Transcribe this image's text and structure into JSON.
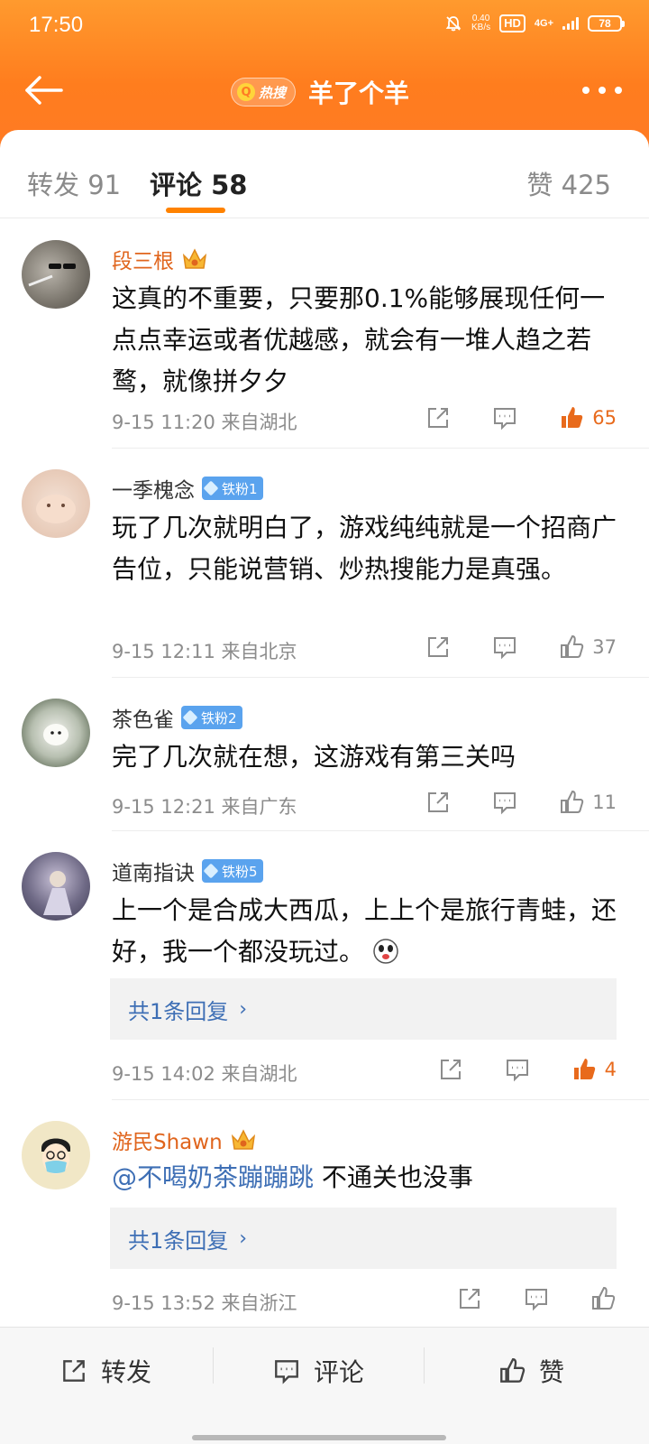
{
  "status_bar": {
    "time": "17:50",
    "speed_value": "0.40",
    "speed_unit": "KB/s",
    "hd_label": "HD",
    "network": "4G+",
    "battery": "78"
  },
  "nav": {
    "hot_badge": "热搜",
    "title": "羊了个羊"
  },
  "tabs": {
    "repost": "转发 91",
    "comments": "评论 58",
    "likes": "赞 425"
  },
  "comments": [
    {
      "user": "段三根",
      "user_type": "vip",
      "text": "这真的不重要，只要那0.1%能够展现任何一点点幸运或者优越感，就会有一堆人趋之若鹜，就像拼夕夕",
      "time": "9-15 11:20",
      "location": "来自湖北",
      "likes": "65",
      "liked": true
    },
    {
      "user": "一季槐念",
      "user_type": "normal",
      "badge": "铁粉1",
      "text": "玩了几次就明白了，游戏纯纯就是一个招商广告位，只能说营销、炒热搜能力是真强。",
      "time": "9-15 12:11",
      "location": "来自北京",
      "likes": "37",
      "liked": false
    },
    {
      "user": "茶色雀",
      "user_type": "normal",
      "badge": "铁粉2",
      "text": "完了几次就在想，这游戏有第三关吗",
      "time": "9-15 12:21",
      "location": "来自广东",
      "likes": "11",
      "liked": false
    },
    {
      "user": "道南指诀",
      "user_type": "normal",
      "badge": "铁粉5",
      "text": "上一个是合成大西瓜，上上个是旅行青蛙，还好，我一个都没玩过。",
      "reply_summary": "共1条回复",
      "time": "9-15 14:02",
      "location": "来自湖北",
      "likes": "4",
      "liked": true
    },
    {
      "user": "游民Shawn",
      "user_type": "vip",
      "mention": "@不喝奶茶蹦蹦跳",
      "text": " 不通关也没事",
      "reply_summary": "共1条回复",
      "time": "9-15 13:52",
      "location": "来自浙江",
      "likes": "",
      "liked": false
    }
  ],
  "bottom_bar": {
    "repost": "转发",
    "comment": "评论",
    "like": "赞"
  },
  "colors": {
    "accent": "#ff8200",
    "header": "#ff7d1e",
    "vip_name": "#e0651d",
    "link": "#3e6fb5",
    "fan_badge": "#5aa3ee"
  }
}
